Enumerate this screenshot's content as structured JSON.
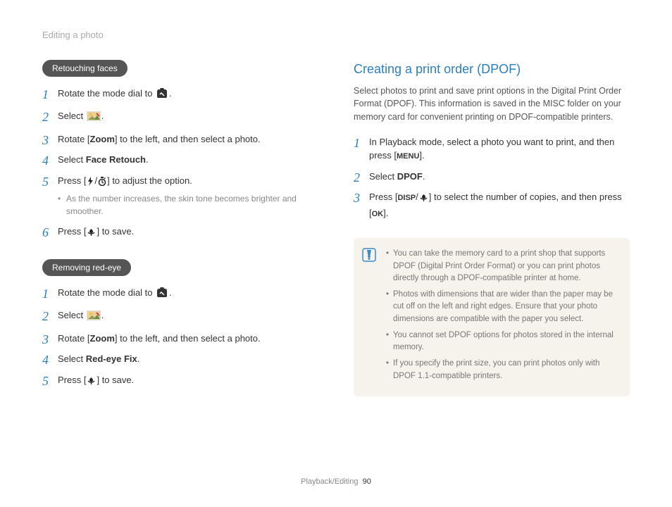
{
  "header": "Editing a photo",
  "left": {
    "section1": {
      "pill": "Retouching faces",
      "steps": [
        {
          "pre": "Rotate the mode dial to ",
          "post": "."
        },
        {
          "pre": "Select ",
          "post": "."
        },
        {
          "pre": "Rotate [",
          "bold": "Zoom",
          "post": "] to the left, and then select a photo."
        },
        {
          "pre": "Select ",
          "bold": "Face Retouch",
          "post": "."
        },
        {
          "pre": "Press [",
          "mid": "/",
          "post": "] to adjust the option.",
          "sub": "As the number increases, the skin tone becomes brighter and smoother."
        },
        {
          "pre": "Press [",
          "post": "] to save."
        }
      ]
    },
    "section2": {
      "pill": "Removing red-eye",
      "steps": [
        {
          "pre": "Rotate the mode dial to ",
          "post": "."
        },
        {
          "pre": "Select ",
          "post": "."
        },
        {
          "pre": "Rotate [",
          "bold": "Zoom",
          "post": "] to the left, and then select a photo."
        },
        {
          "pre": "Select ",
          "bold": "Red-eye Fix",
          "post": "."
        },
        {
          "pre": "Press [",
          "post": "] to save."
        }
      ]
    }
  },
  "right": {
    "title": "Creating a print order (DPOF)",
    "intro": "Select photos to print and save print options in the Digital Print Order Format (DPOF). This information is saved in the MISC folder on your memory card for convenient printing on DPOF-compatible printers.",
    "steps": [
      {
        "pre": "In Playback mode, select a photo you want to print, and then press [",
        "icon_text": "MENU",
        "post": "]."
      },
      {
        "pre": "Select ",
        "bold": "DPOF",
        "post": "."
      },
      {
        "pre": "Press [",
        "icon_text1": "DISP",
        "mid": "/",
        "post1": "] to select the number of copies, and then press [",
        "icon_text2": "OK",
        "post2": "]."
      }
    ],
    "notes": [
      "You can take the memory card to a print shop that supports DPOF (Digital Print Order Format) or you can print photos directly through a DPOF-compatible printer at home.",
      "Photos with dimensions that are wider than the paper may be cut off on the left and right edges. Ensure that your photo dimensions are compatible with the paper you select.",
      "You cannot set DPOF options for photos stored in the internal memory.",
      "If you specify the print size, you can print photos only with DPOF 1.1-compatible printers."
    ]
  },
  "footer": {
    "section": "Playback/Editing",
    "page": "90"
  }
}
